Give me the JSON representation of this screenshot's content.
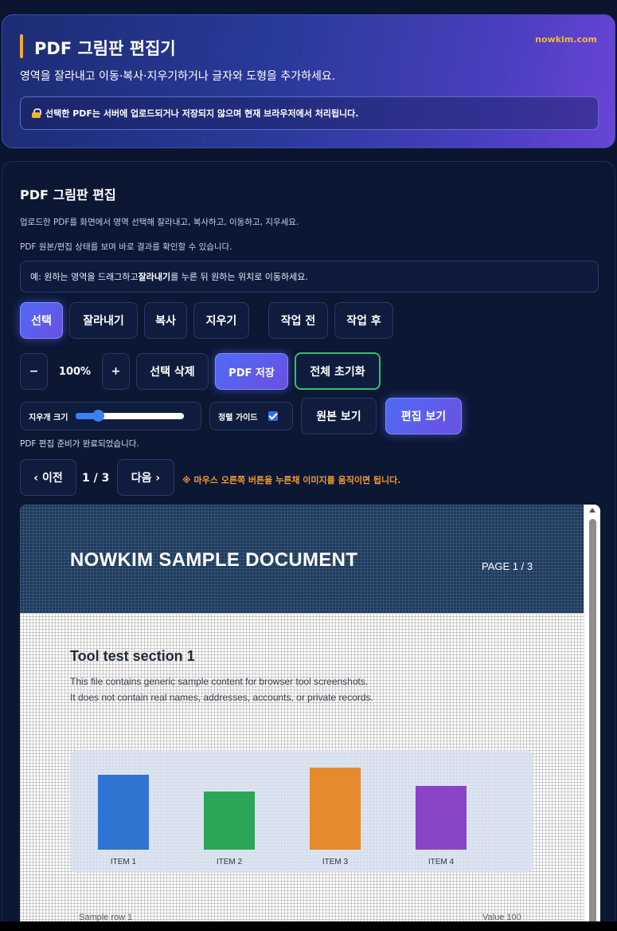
{
  "header": {
    "title": "PDF 그림판 편집기",
    "brand": "nowkim.com",
    "subtitle": "영역을 잘라내고 이동·복사·지우기하거나 글자와 도형을 추가하세요.",
    "privacy_note": "선택한 PDF는 서버에 업로드되거나 저장되지 않으며 현재 브라우저에서 처리됩니다."
  },
  "editor": {
    "section_title": "PDF 그림판 편집",
    "desc1": "업로드한 PDF를 화면에서 영역 선택해 잘라내고, 복사하고, 이동하고, 지우세요.",
    "desc2": "PDF 원본/편집 상태를 보며 바로 결과를 확인할 수 있습니다.",
    "hint_prefix": "예: 원하는 영역을 드래그하고 ",
    "hint_bold": "잘라내기",
    "hint_suffix": "를 누른 뒤 원하는 위치로 이동하세요.",
    "tools": {
      "select": "선택",
      "cut": "잘라내기",
      "copy": "복사",
      "erase": "지우기",
      "before": "작업 전",
      "after": "작업 후"
    },
    "zoom": {
      "minus": "−",
      "value": "100%",
      "plus": "+"
    },
    "actions": {
      "delete_selection": "선택 삭제",
      "save_pdf": "PDF 저장",
      "reset_all": "전체 초기화"
    },
    "eraser": {
      "label": "지우개 크기",
      "value_fraction": 0.2
    },
    "guide": {
      "label": "정렬 가이드",
      "checked": true
    },
    "views": {
      "original": "원본 보기",
      "edited": "편집 보기"
    },
    "status": "PDF 편집 준비가 완료되었습니다.",
    "pager": {
      "prev": "‹ 이전",
      "indicator": "1 / 3",
      "next": "다음 ›"
    },
    "tip": "※ 마우스 오른쪽 버튼을 누른채 이미지를 움직이면 됩니다."
  },
  "document": {
    "title": "NOWKIM SAMPLE DOCUMENT",
    "page_label": "PAGE 1 / 3",
    "section_heading": "Tool test section 1",
    "line1": "This file contains generic sample content for browser tool screenshots.",
    "line2": "It does not contain real names, addresses, accounts, or private records.",
    "row_label": "Sample row 1",
    "row_value": "Value 100"
  },
  "chart_data": {
    "type": "bar",
    "categories": [
      "ITEM 1",
      "ITEM 2",
      "ITEM 3",
      "ITEM 4"
    ],
    "values": [
      92,
      72,
      101,
      79
    ],
    "ylim": [
      0,
      110
    ],
    "colors": [
      "#2f74d0",
      "#2aa656",
      "#e58a2e",
      "#8a44c8"
    ],
    "grid": false
  },
  "colors": {
    "accent": "#5b6cf0",
    "brand": "#f3b643",
    "tip": "#f09a32",
    "reset_border": "#29c46b"
  }
}
